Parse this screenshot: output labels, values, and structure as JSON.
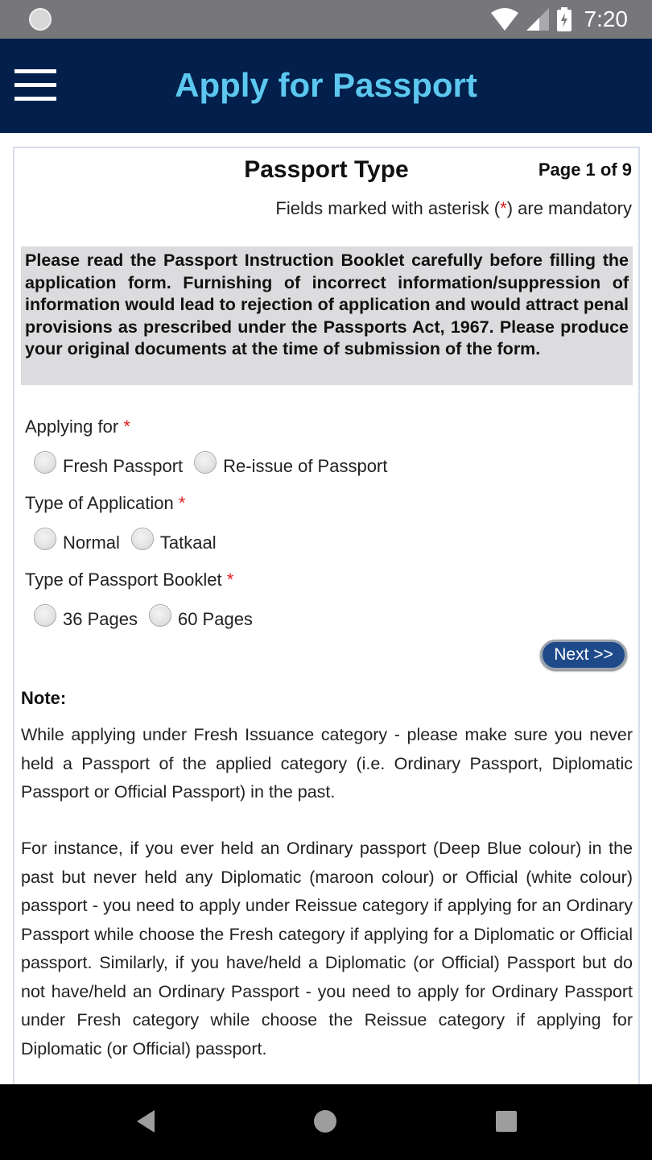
{
  "status_bar": {
    "time": "7:20",
    "icons": [
      "notification-spinner-icon",
      "wifi-icon",
      "signal-icon",
      "battery-charging-icon"
    ]
  },
  "app_bar": {
    "title": "Apply for Passport",
    "menu_icon": "hamburger-menu-icon"
  },
  "header": {
    "section_title": "Passport Type",
    "page_indicator": "Page 1 of 9",
    "mandatory_prefix": "Fields marked with asterisk (",
    "mandatory_asterisk": "*",
    "mandatory_suffix": ") are mandatory"
  },
  "instruction": "Please read the Passport Instruction Booklet carefully before filling the application form. Furnishing of incorrect information/suppression of information would lead to rejection of application and would attract penal provisions as prescribed under the Passports Act, 1967. Please produce your original documents at the time of submission of the form.",
  "form": {
    "required_marker": "*",
    "groups": [
      {
        "label": "Applying for",
        "options": [
          {
            "label": "Fresh Passport",
            "checked": false
          },
          {
            "label": "Re-issue of Passport",
            "checked": false
          }
        ]
      },
      {
        "label": "Type of Application",
        "options": [
          {
            "label": "Normal",
            "checked": false
          },
          {
            "label": "Tatkaal",
            "checked": false
          }
        ]
      },
      {
        "label": "Type of Passport Booklet",
        "options": [
          {
            "label": "36 Pages",
            "checked": false
          },
          {
            "label": "60 Pages",
            "checked": false
          }
        ]
      }
    ],
    "next_button": "Next >>"
  },
  "note": {
    "label": "Note:",
    "paragraphs": [
      "While applying under Fresh Issuance category - please make sure you never held a Passport of the applied category (i.e. Ordinary Passport, Diplomatic Passport or Official Passport) in the past.",
      "For instance, if you ever held an Ordinary passport (Deep Blue colour) in the past but never held any Diplomatic (maroon colour) or Official (white colour) passport - you need to apply under Reissue category if applying for an Ordinary Passport while choose the Fresh category if applying for a Diplomatic or Official passport. Similarly, if you have/held a Diplomatic (or Official) Passport but do not have/held an Ordinary Passport - you need to apply for Ordinary Passport under Fresh category while choose the Reissue category if applying for Diplomatic (or Official) passport."
    ]
  },
  "colors": {
    "app_bar_bg": "#02204b",
    "title_color": "#5cc8f0",
    "required_red": "#e0201e",
    "button_bg": "#1f4a8a",
    "instruction_bg": "#dcdcdf"
  },
  "nav_bar": {
    "icons": [
      "back-icon",
      "home-icon",
      "recents-icon"
    ]
  }
}
